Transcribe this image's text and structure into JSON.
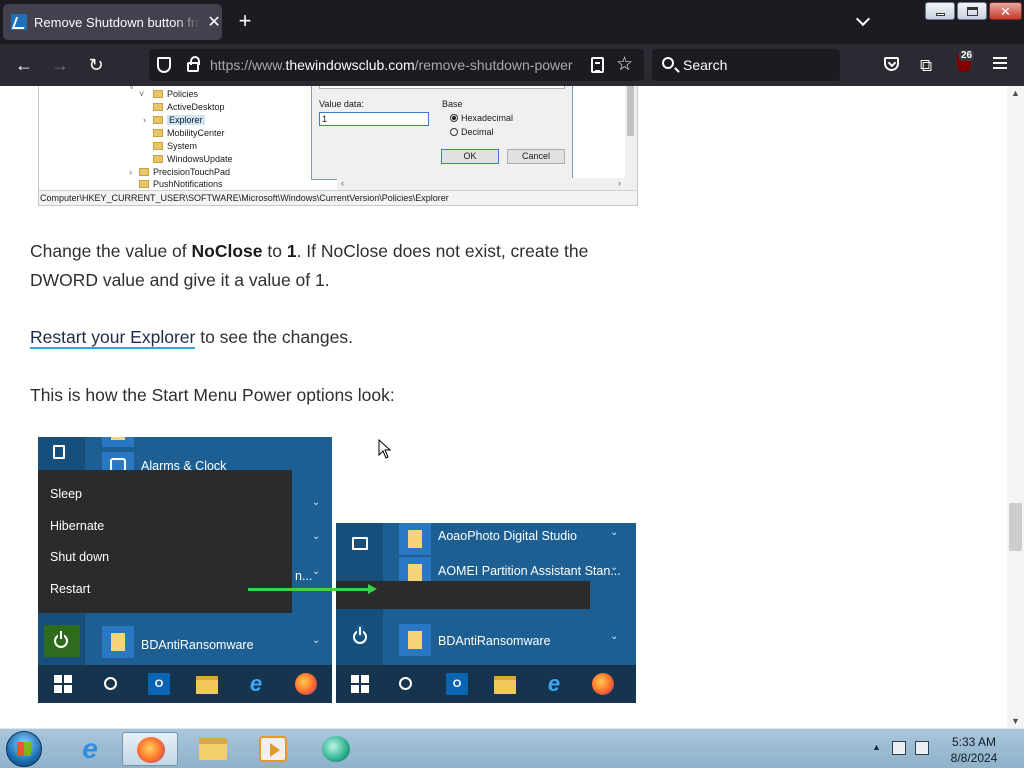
{
  "browser": {
    "tab_title": "Remove Shutdown button from Start Menu",
    "url_prefix": "https://www.",
    "url_domain": "thewindowsclub.com",
    "url_path": "/remove-shutdown-power",
    "search_placeholder": "Search",
    "notification_badge": "26"
  },
  "registry_figure": {
    "tree_items": [
      "Policies",
      "ActiveDesktop",
      "Explorer",
      "MobilityCenter",
      "System",
      "WindowsUpdate",
      "PrecisionTouchPad",
      "PushNotifications"
    ],
    "value_data_label": "Value data:",
    "value_data": "1",
    "base_label": "Base",
    "radio_hex": "Hexadecimal",
    "radio_dec": "Decimal",
    "ok_label": "OK",
    "cancel_label": "Cancel",
    "status_path": "Computer\\HKEY_CURRENT_USER\\SOFTWARE\\Microsoft\\Windows\\CurrentVersion\\Policies\\Explorer"
  },
  "article": {
    "p1_a": "Change the value of ",
    "p1_b": "NoClose",
    "p1_c": " to ",
    "p1_d": "1",
    "p1_e": ". If NoClose does not exist, create the DWORD value and give it a value of 1.",
    "p2_link": "Restart your Explorer",
    "p2_rest": " to see the changes.",
    "p3": "This is how the Start Menu Power options look:"
  },
  "startmenu_left": {
    "app_alarms": "Alarms & Clock",
    "power_items": [
      "Sleep",
      "Hibernate",
      "Shut down",
      "Restart"
    ],
    "app_bd": "BDAntiRansomware",
    "partial_label": "n..."
  },
  "startmenu_right": {
    "apps": [
      "AoaoPhoto Digital Studio",
      "AOMEI Partition Assistant Stan...",
      "BDAntiRansomware"
    ]
  },
  "taskbar": {
    "time": "5:33 AM",
    "date": "8/8/2024"
  }
}
